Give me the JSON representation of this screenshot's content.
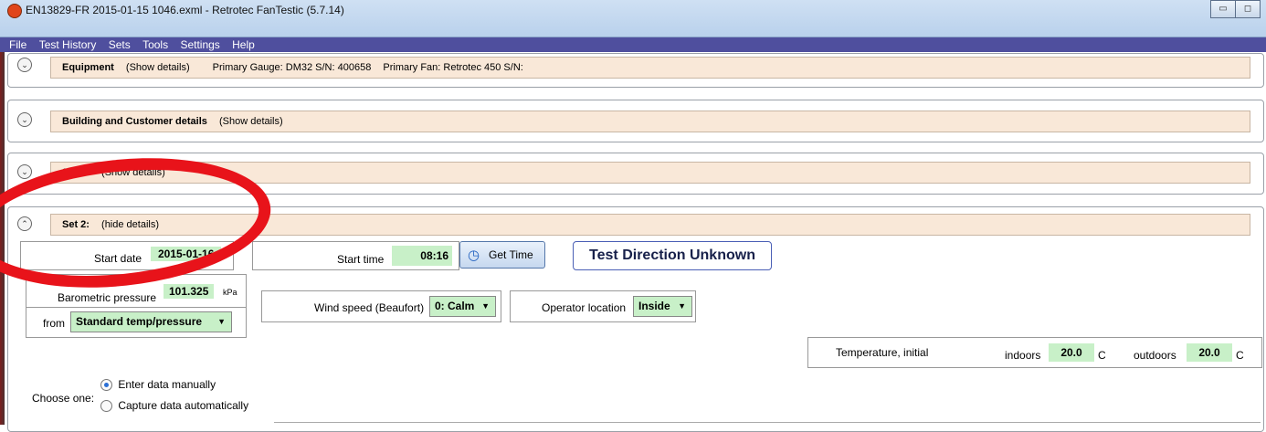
{
  "window": {
    "title": "EN13829-FR 2015-01-15 1046.exml - Retrotec FanTestic (5.7.14)",
    "minimize_glyph": "▭",
    "maximize_glyph": "◻"
  },
  "menu": [
    "File",
    "Test History",
    "Sets",
    "Tools",
    "Settings",
    "Help"
  ],
  "sections": {
    "equipment": {
      "title": "Equipment",
      "show_details": "(Show details)",
      "primary_gauge": "Primary Gauge: DM32 S/N: 400658",
      "primary_fan": "Primary Fan: Retrotec 450 S/N:"
    },
    "building": {
      "title": "Building and Customer details",
      "show_details": "(Show details)"
    },
    "set1": {
      "title": "Set 1:",
      "show_details": "(Show details)"
    },
    "set2": {
      "title": "Set 2:",
      "hide_details": "(hide details)"
    }
  },
  "set2": {
    "start_date_label": "Start date",
    "start_date_value": "2015-01-16",
    "start_time_label": "Start time",
    "start_time_value": "08:16",
    "get_time_label": "Get Time",
    "test_direction": "Test Direction Unknown",
    "barometric_label": "Barometric pressure",
    "barometric_value": "101.325",
    "barometric_unit": "kPa",
    "from_label": "from",
    "from_value": "Standard temp/pressure",
    "wind_label": "Wind speed (Beaufort)",
    "wind_value": "0: Calm",
    "operator_label": "Operator location",
    "operator_value": "Inside",
    "temp_label": "Temperature, initial",
    "indoors_label": "indoors",
    "indoors_value": "20.0",
    "indoors_unit": "C",
    "outdoors_label": "outdoors",
    "outdoors_value": "20.0",
    "outdoors_unit": "C",
    "choose_label": "Choose one:",
    "radio_manual": "Enter data manually",
    "radio_auto": "Capture data automatically"
  },
  "colors": {
    "menubar": "#4f4f9e",
    "header_fill": "#f9e8d8",
    "value_green": "#c8f0c8",
    "annotation_ring": "#e8131a"
  }
}
